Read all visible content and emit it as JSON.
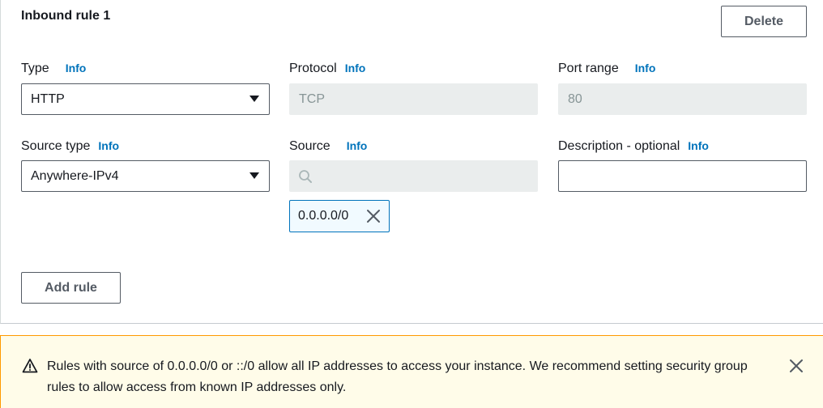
{
  "rule": {
    "title": "Inbound rule 1",
    "delete_label": "Delete",
    "add_rule_label": "Add rule"
  },
  "info_link": "Info",
  "fields": {
    "type": {
      "label": "Type",
      "value": "HTTP"
    },
    "protocol": {
      "label": "Protocol",
      "value": "TCP"
    },
    "port_range": {
      "label": "Port range",
      "value": "80"
    },
    "source_type": {
      "label": "Source type",
      "value": "Anywhere-IPv4"
    },
    "source": {
      "label": "Source",
      "value": "",
      "token": "0.0.0.0/0"
    },
    "description": {
      "label": "Description - optional",
      "value": ""
    }
  },
  "warning": {
    "text": "Rules with source of 0.0.0.0/0 or ::/0 allow all IP addresses to access your instance. We recommend setting security group rules to allow access from known IP addresses only."
  },
  "colors": {
    "link": "#0073bb",
    "warning_bg": "#fffce9",
    "warning_border": "#ff9900",
    "disabled_bg": "#eaeded"
  },
  "icons": {
    "dropdown": "caret-down-icon",
    "search": "search-icon",
    "remove_token": "close-icon",
    "warning": "warning-triangle-icon",
    "dismiss": "close-icon"
  }
}
